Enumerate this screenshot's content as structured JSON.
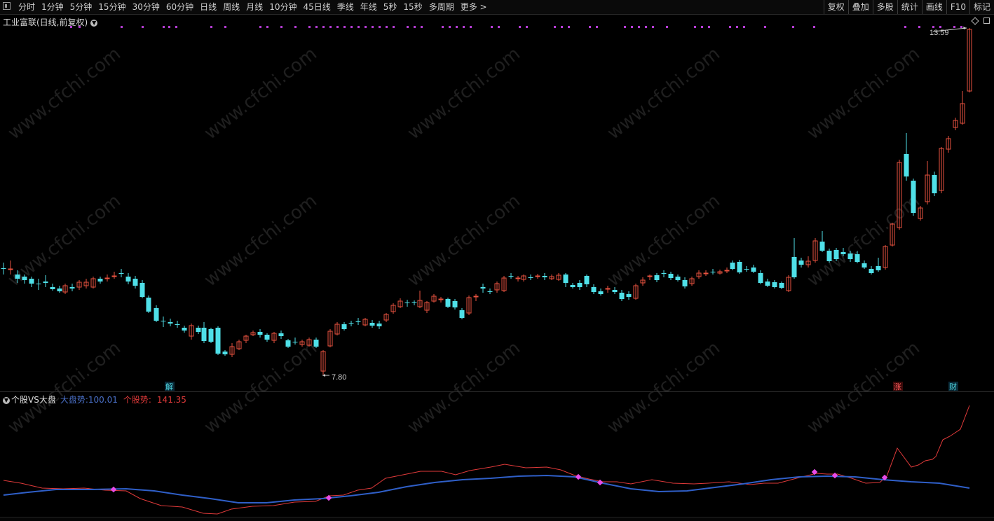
{
  "toolbar": {
    "periods": [
      "分时",
      "1分钟",
      "5分钟",
      "15分钟",
      "30分钟",
      "60分钟",
      "日线",
      "周线",
      "月线",
      "10分钟",
      "45日线",
      "季线",
      "年线",
      "5秒",
      "15秒",
      "多周期",
      "更多 >"
    ],
    "tools": [
      "复权",
      "叠加",
      "多股",
      "统计",
      "画线",
      "F10",
      "标记"
    ]
  },
  "chart": {
    "title": "工业富联(日线,前复权)",
    "high_label": "13.59",
    "low_label": "7.80",
    "markers": {
      "jie": "解",
      "zhang": "涨",
      "cai": "财"
    },
    "colors": {
      "up": "#e8523f",
      "down": "#4fe0e8",
      "signal_dot": "#b43cd2"
    }
  },
  "indicator": {
    "name": "个股VS大盘",
    "market_label": "大盘势:",
    "market_value": "100.01",
    "stock_label": "个股势:",
    "stock_value": "141.35",
    "colors": {
      "market": "#2f5fc8",
      "stock": "#e03a3a",
      "cross_dot": "#e84be8"
    }
  }
}
